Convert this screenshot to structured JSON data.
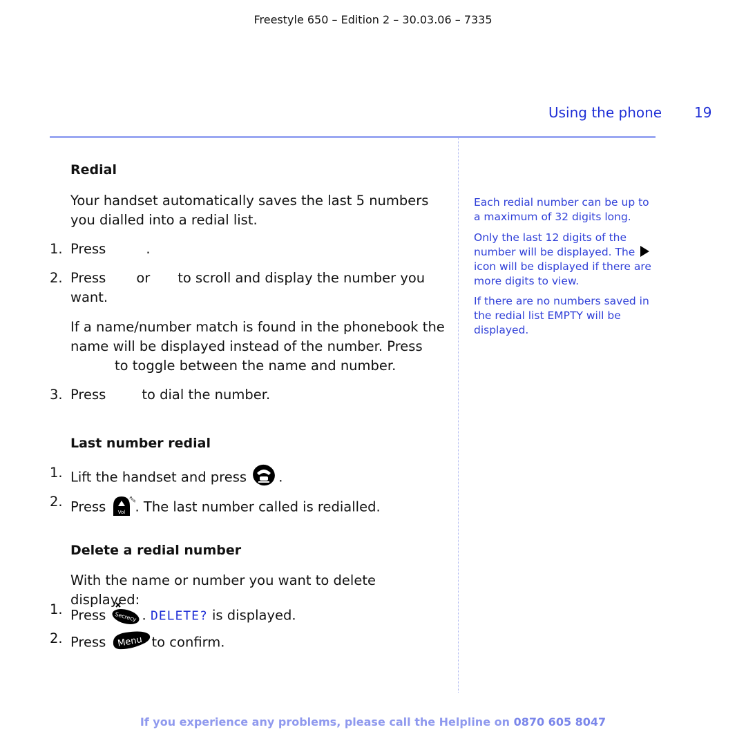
{
  "document_header": "Freestyle 650 – Edition 2 – 30.03.06 – 7335",
  "page_header": {
    "section_title": "Using the phone",
    "page_number": "19"
  },
  "redial": {
    "heading": "Redial",
    "intro": "Your handset automatically saves the last 5 numbers you dialled into a redial list.",
    "steps": [
      {
        "num": "1.",
        "before": "Press",
        "after": "."
      },
      {
        "num": "2.",
        "before": "Press",
        "middle": "or",
        "after": "to scroll and display the number you want."
      },
      {
        "num": "3.",
        "before": "Press",
        "after": "to dial the number."
      }
    ],
    "note_line1": "If a name/number match is found in the phonebook the name will be displayed instead of the number. Press",
    "note_line2": "to toggle between the name and number."
  },
  "last_number_redial": {
    "heading": "Last number redial",
    "steps": [
      {
        "num": "1.",
        "before": "Lift the handset and press",
        "icon": "talk-icon",
        "after": "."
      },
      {
        "num": "2.",
        "before": "Press",
        "icon": "redial-vol-up-icon",
        "icon_label": "Vol",
        "icon_sublabel": "Redial",
        "after": ". The last number called is redialled."
      }
    ]
  },
  "delete_redial": {
    "heading": "Delete a redial number",
    "intro": "With the name or number you want to delete displayed:",
    "steps": [
      {
        "num": "1.",
        "before": "Press",
        "icon": "secrecy-delete-icon",
        "icon_label": "Secrecy",
        "display_text": "DELETE?",
        "after": "is displayed."
      },
      {
        "num": "2.",
        "before": "Press",
        "icon": "menu-button-icon",
        "icon_label": "Menu",
        "after": "to confirm."
      }
    ]
  },
  "sidebar_notes": [
    "Each redial number can be up to a maximum of 32 digits long.",
    {
      "before": "Only the last 12 digits of the number will be displayed. The",
      "icon": "right-arrow-icon",
      "after": "icon will be displayed if there are more digits to view."
    },
    "If there are no numbers saved in the redial list EMPTY will be displayed."
  ],
  "footer": {
    "text": "If you experience any problems, please call the Helpline on",
    "phone": "0870 605 8047"
  },
  "colors": {
    "accent_blue": "#1f2fd6",
    "side_note_blue": "#3040d8",
    "rule_blue": "#9aa7f2",
    "footer_blue": "#8f99ee"
  }
}
